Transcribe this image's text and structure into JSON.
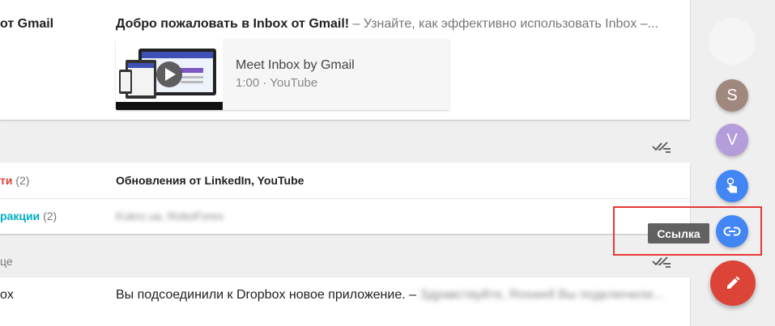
{
  "top_email": {
    "sender": "от Gmail",
    "subject": "Добро пожаловать в Inbox от Gmail!",
    "snippet": " – Узнайте, как эффективно использовать Inbox –...",
    "video": {
      "title": "Meet Inbox by Gmail",
      "meta": "1:00 · YouTube"
    }
  },
  "bundles": [
    {
      "label": "ти",
      "count": "(2)",
      "color": "#db4437",
      "subject_bold": "Обновления от LinkedIn",
      "subject_rest": ", YouTube"
    },
    {
      "label": "ракции",
      "count": "(2)",
      "color": "#00acc1",
      "subject_blurred": "Kukro ua, RoboForex"
    }
  ],
  "section_label": "це",
  "dropbox_row": {
    "sender": "ox",
    "subject": "Вы подсоединили к Dropbox новое приложение. –",
    "snippet_blurred": " Здравствуйте, Roswell Вы подключили..."
  },
  "fab": {
    "contacts": [
      {
        "initial": "S",
        "color": "#a1887f"
      },
      {
        "initial": "V",
        "color": "#b39ddb"
      }
    ],
    "reminder_color": "#4285f4",
    "link_color": "#4285f4",
    "link_tooltip": "Ссылка",
    "compose_color": "#db4437"
  },
  "highlight_color": "#e53935"
}
